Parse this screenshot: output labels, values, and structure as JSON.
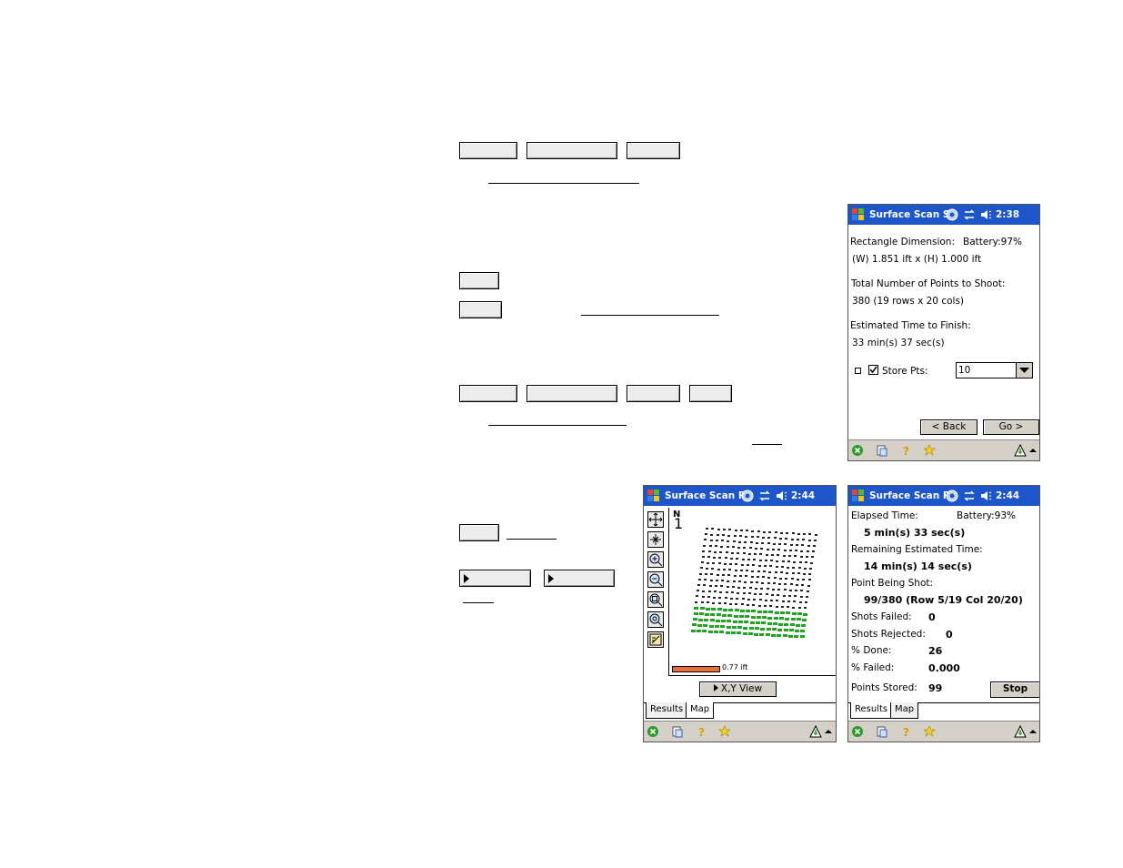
{
  "screen1": {
    "title": "Surface Scan St",
    "time": "2:38",
    "rect_label": "Rectangle Dimension:",
    "battery": "Battery:97%",
    "dimension": "(W) 1.851 ift x (H) 1.000 ift",
    "points_label": "Total Number of Points to Shoot:",
    "points_value": "380  (19 rows x 20 cols)",
    "time_label": "Estimated Time to Finish:",
    "time_value": "33 min(s) 37 sec(s)",
    "store_label": "Store Pts:",
    "store_checked": true,
    "store_value": "10",
    "back_label": "< Back",
    "go_label": "Go >"
  },
  "screen2": {
    "title": "Surface Scan Re",
    "time": "2:44",
    "north": "N",
    "north_num": "1",
    "scale_label": "0.77 ift",
    "view_button": "X,Y View",
    "tab_results": "Results",
    "tab_map": "Map",
    "active_tab": "Map",
    "tools": [
      "pan-tool-icon",
      "center-tool-icon",
      "zoom-in-icon",
      "zoom-out-icon",
      "zoom-window-icon",
      "zoom-extents-icon",
      "settings-tool-icon"
    ]
  },
  "screen3": {
    "title": "Surface Scan Re",
    "time": "2:44",
    "elapsed_label": "Elapsed Time:",
    "battery": "Battery:93%",
    "elapsed_value": "5 min(s) 33 sec(s)",
    "remaining_label": "Remaining Estimated Time:",
    "remaining_value": "14 min(s) 14 sec(s)",
    "point_label": "Point Being Shot:",
    "point_value": "99/380 (Row 5/19  Col 20/20)",
    "failed_label": "Shots Failed:",
    "failed_value": "0",
    "rejected_label": "Shots Rejected:",
    "rejected_value": "0",
    "done_label": "% Done:",
    "done_value": "26",
    "pfailed_label": "% Failed:",
    "pfailed_value": "0.000",
    "stored_label": "Points Stored:",
    "stored_value": "99",
    "stop_label": "Stop",
    "tab_results": "Results",
    "tab_map": "Map",
    "active_tab": "Results"
  },
  "colors": {
    "titlebar": "#1c56c8",
    "menubar": "#d4d0c8",
    "scale_bar": "#e8703a",
    "shot_points": "#1fa51f"
  }
}
